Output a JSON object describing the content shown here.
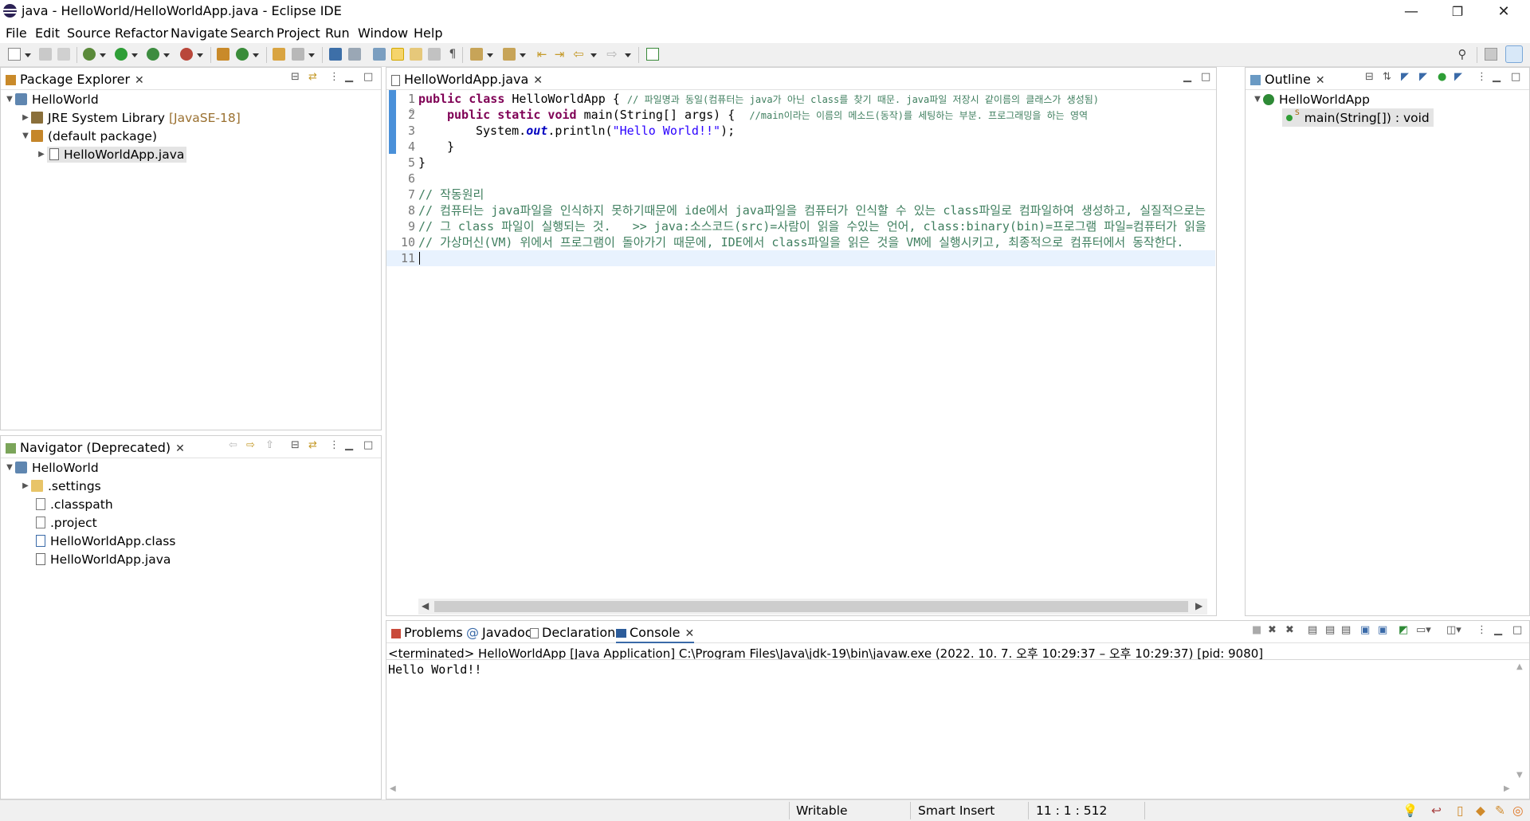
{
  "window": {
    "title": "java - HelloWorld/HelloWorldApp.java - Eclipse IDE",
    "minimize": "—",
    "restore": "❐",
    "close": "✕"
  },
  "menu": [
    "File",
    "Edit",
    "Source",
    "Refactor",
    "Navigate",
    "Search",
    "Project",
    "Run",
    "Window",
    "Help"
  ],
  "package_explorer": {
    "tab": "Package Explorer",
    "items": [
      {
        "label": "HelloWorld",
        "icon": "project-icon"
      },
      {
        "label": "JRE System Library",
        "suffix": "[JavaSE-18]",
        "icon": "library-icon"
      },
      {
        "label": "(default package)",
        "icon": "package-icon"
      },
      {
        "label": "HelloWorldApp.java",
        "icon": "java-file-icon"
      }
    ]
  },
  "navigator": {
    "tab": "Navigator (Deprecated)",
    "items": [
      {
        "label": "HelloWorld",
        "icon": "project-icon"
      },
      {
        "label": ".settings",
        "icon": "folder-icon"
      },
      {
        "label": ".classpath",
        "icon": "xml-file-icon"
      },
      {
        "label": ".project",
        "icon": "xml-file-icon"
      },
      {
        "label": "HelloWorldApp.class",
        "icon": "class-file-icon"
      },
      {
        "label": "HelloWorldApp.java",
        "icon": "java-file-icon"
      }
    ]
  },
  "editor": {
    "tab": "HelloWorldApp.java",
    "line_numbers": [
      "1",
      "2",
      "3",
      "4",
      "5",
      "6",
      "7",
      "8",
      "9",
      "10",
      "11"
    ],
    "lines": {
      "l1_kw": "public class",
      "l1_name": " HelloWorldApp { ",
      "l1_cm": "// 파일명과 동일(컴퓨터는 java가 아닌 class를 찾기 때문. java파일 저장시 같이름의 클래스가 생성됨)",
      "l2_kw": "public static void",
      "l2_rest": " main(String[] args) {  ",
      "l2_cm": "//main이라는 이름의 메소드(동작)를 세팅하는 부분. 프로그래밍을 하는 영역",
      "l3_a": "System.",
      "l3_field": "out",
      "l3_b": ".println(",
      "l3_str": "\"Hello World!!\"",
      "l3_c": ");",
      "l4": "}",
      "l5": "}",
      "l7": "// 작동원리",
      "l8": "// 컴퓨터는 java파일을 인식하지 못하기때문에 ide에서 java파일을 컴퓨터가 인식할 수 있는 class파일로 컴파일하여 생성하고, 실질적으로는",
      "l9": "// 그 class 파일이 실행되는 것.   >> java:소스코드(src)=사람이 읽을 수있는 언어, class:binary(bin)=프로그램 파일=컴퓨터가 읽을 수 있는 언",
      "l10": "// 가상머신(VM) 위에서 프로그램이 돌아가기 때문에, IDE에서 class파일을 읽은 것을 VM에 실행시키고, 최종적으로 컴퓨터에서 동작한다."
    }
  },
  "outline": {
    "tab": "Outline",
    "items": [
      {
        "label": "HelloWorldApp",
        "icon": "class-icon"
      },
      {
        "label": "main(String[]) : void",
        "icon": "method-icon"
      }
    ]
  },
  "bottom": {
    "tabs": [
      "Problems",
      "Javadoc",
      "Declaration",
      "Console"
    ],
    "console_header": "<terminated> HelloWorldApp [Java Application] C:\\Program Files\\Java\\jdk-19\\bin\\javaw.exe  (2022. 10. 7. 오후 10:29:37 – 오후 10:29:37) [pid: 9080]",
    "console_output": "Hello World!!"
  },
  "status": {
    "writable": "Writable",
    "insert_mode": "Smart Insert",
    "position": "11 : 1 : 512"
  },
  "colors": {
    "keyword": "#7f0055",
    "comment": "#3f7f5f",
    "string": "#2a00ff",
    "field": "#0000c0",
    "line_highlight": "#e8f2fe",
    "scroll_marker": "#4a90d9"
  }
}
